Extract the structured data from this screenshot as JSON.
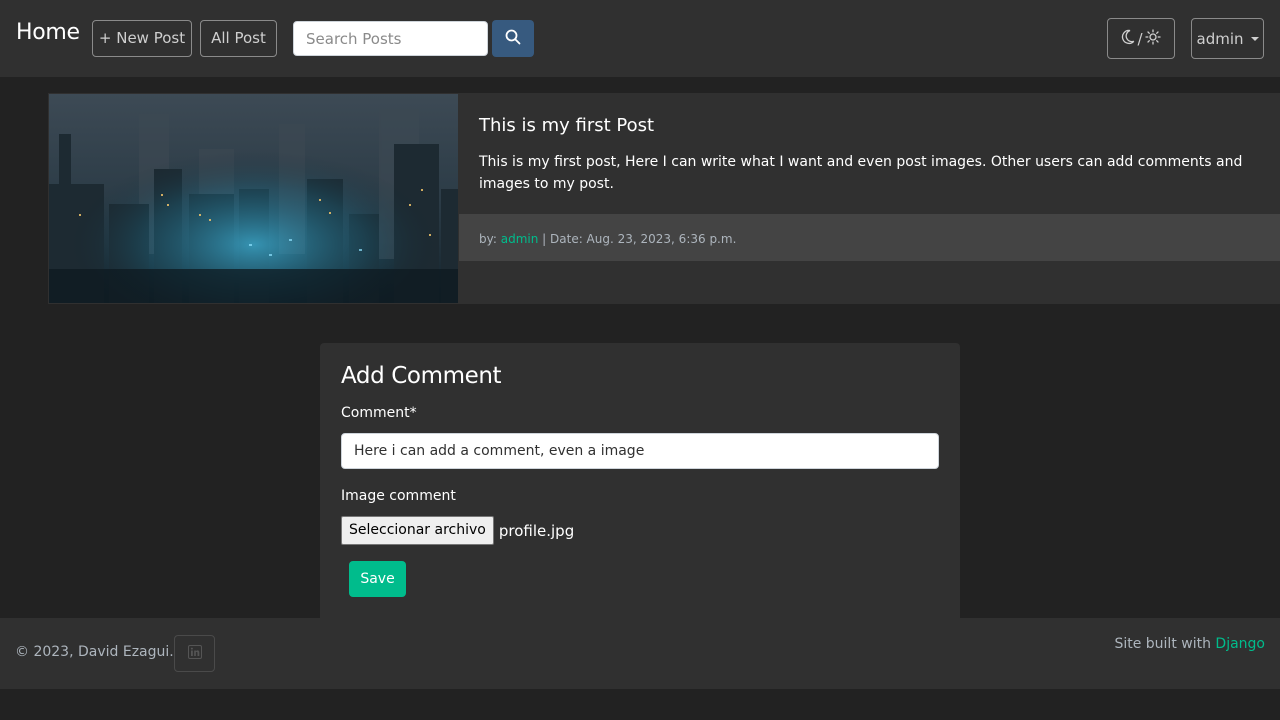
{
  "navbar": {
    "brand": "Home",
    "new_post_label": "+ New Post",
    "all_post_label": "All Post",
    "search_placeholder": "Search Posts",
    "theme_toggle_separator": "/",
    "user_label": "admin"
  },
  "post": {
    "title": "This is my first Post",
    "body": "This is my first post, Here I can write what I want and even post images. Other users can add comments and images to my post.",
    "by_label": "by:",
    "author": "admin",
    "date_text": "| Date: Aug. 23, 2023, 6:36 p.m."
  },
  "comment_form": {
    "title": "Add Comment",
    "comment_label": "Comment*",
    "comment_value": "Here i can add a comment, even a image",
    "image_label": "Image comment",
    "file_button_label": "Seleccionar archivo",
    "file_name": "profile.jpg",
    "save_label": "Save"
  },
  "footer": {
    "copyright": "© 2023, David Ezagui.",
    "built_with_prefix": "Site built with",
    "built_with_link": "Django"
  },
  "icons": {
    "search": "search-icon",
    "theme_moon": "moon-icon",
    "theme_sun": "sun-icon",
    "linkedin": "linkedin-icon"
  },
  "colors": {
    "background": "#222222",
    "surface": "#303030",
    "accent": "#00bc8c",
    "primary": "#375a7f",
    "muted_text": "#adb5bd"
  }
}
